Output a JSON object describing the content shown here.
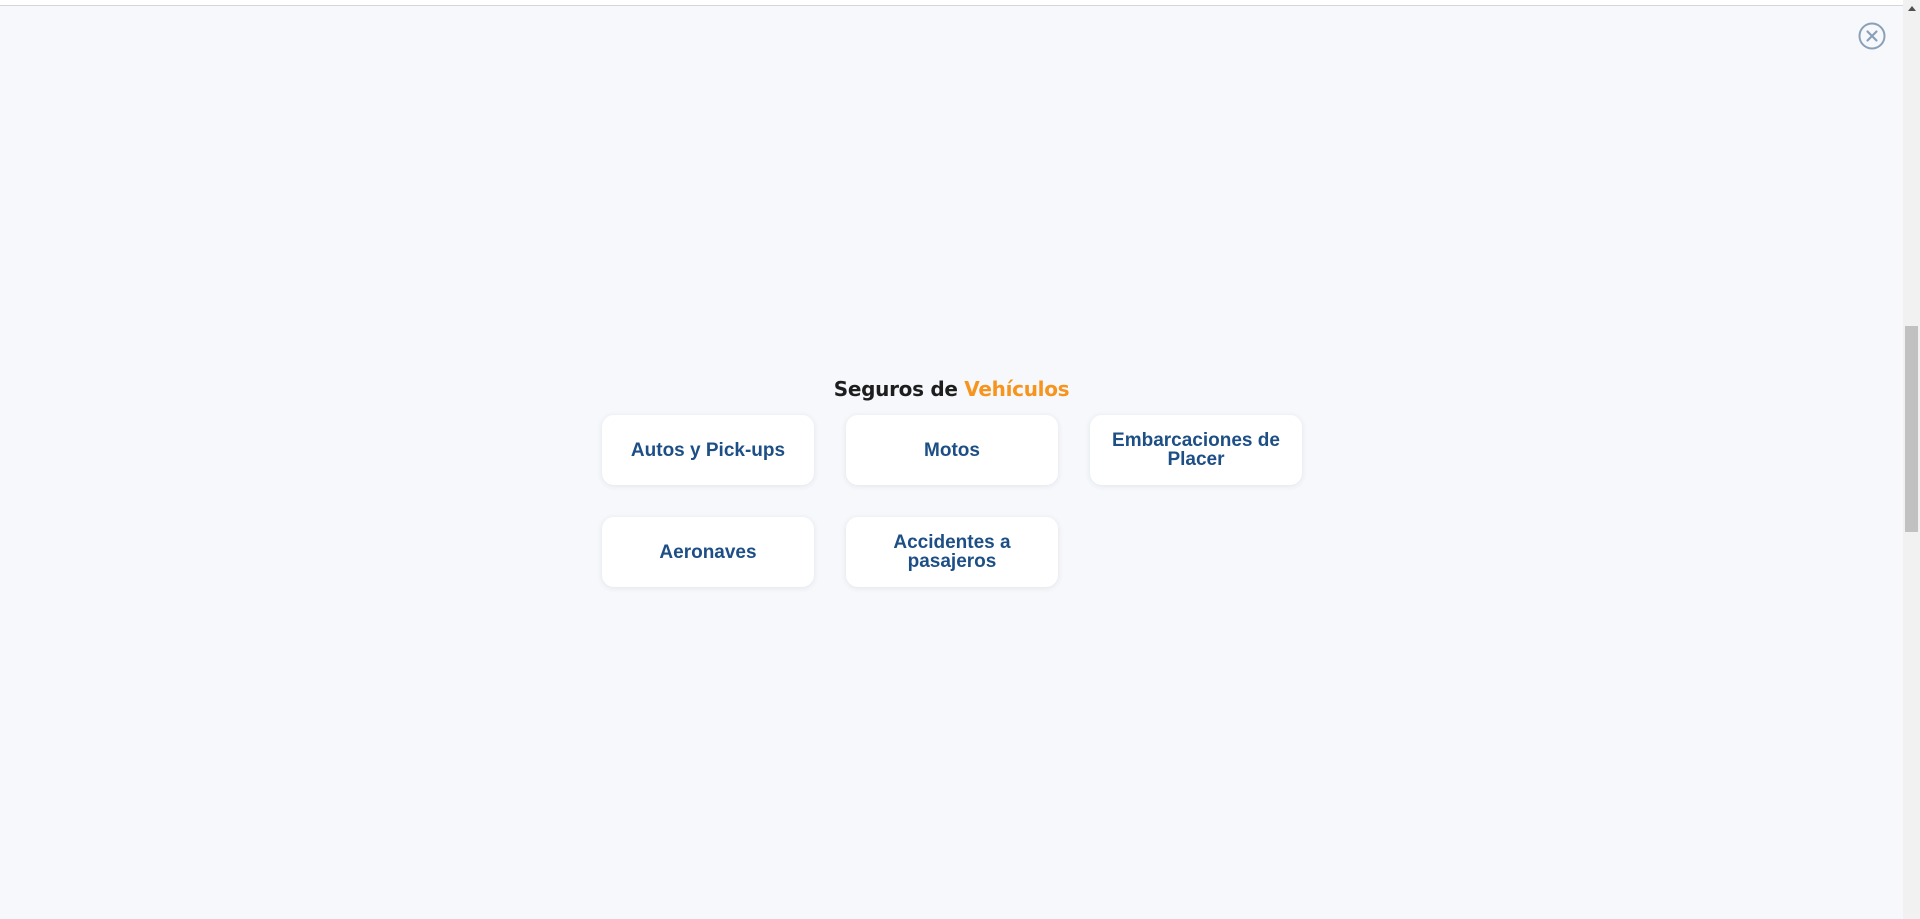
{
  "modal": {
    "close_icon": "close-circle-icon",
    "title_part1": "Seguros de ",
    "title_part2": "Vehículos",
    "accent_color": "#f7941d",
    "text_color": "#1d4f86"
  },
  "options": [
    {
      "label": "Autos y Pick-ups"
    },
    {
      "label": "Motos"
    },
    {
      "label": "Embarcaciones de Placer"
    },
    {
      "label": "Aeronaves"
    },
    {
      "label": "Accidentes a pasajeros"
    }
  ]
}
